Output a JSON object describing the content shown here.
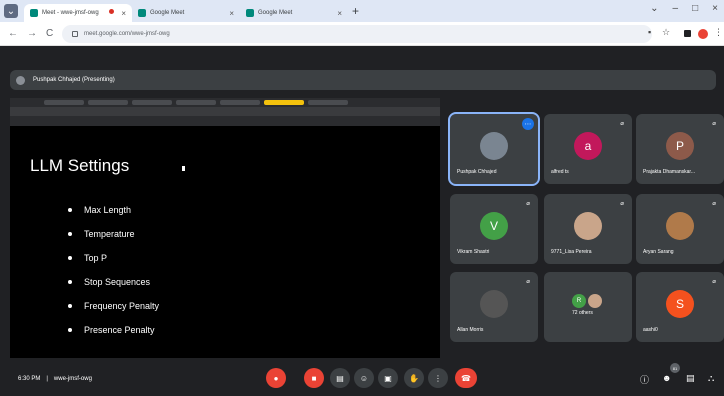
{
  "browser": {
    "tabs": [
      {
        "title": "Meet - wwe-jmsf-owg",
        "favicon_color": "#00897b"
      },
      {
        "title": "Google Meet",
        "favicon_color": "#00897b"
      },
      {
        "title": "Google Meet",
        "favicon_color": "#00897b"
      }
    ],
    "tab_close": "×",
    "new_tab": "+",
    "window_controls": [
      "⌄",
      "–",
      "□",
      "×"
    ],
    "url": "meet.google.com/wwe-jmsf-owg",
    "nav": [
      "←",
      "→",
      "C"
    ]
  },
  "presenter_bar": {
    "label": "Pushpak Chhajed (Presenting)"
  },
  "slide": {
    "title": "LLM Settings",
    "bullets": [
      "Max Length",
      "Temperature",
      "Top P",
      "Stop Sequences",
      "Frequency Penalty",
      "Presence Penalty"
    ]
  },
  "participants": [
    {
      "name": "Pushpak Chhajed",
      "avatar": "",
      "color": "#7a8591",
      "speaking": true
    },
    {
      "name": "alfred ts",
      "avatar": "a",
      "color": "#c2185b"
    },
    {
      "name": "Prajakta Dhamanskar...",
      "avatar": "P",
      "color": "#8d5a4a"
    },
    {
      "name": "Vikram Shastri",
      "avatar": "V",
      "color": "#43a047"
    },
    {
      "name": "9771_Lisa Pereira",
      "avatar": "",
      "color": "#c9a58a"
    },
    {
      "name": "Aryan Sarang",
      "avatar": "",
      "color": "#b07a4a"
    },
    {
      "name": "Allan Morris",
      "avatar": "",
      "color": "#555"
    },
    {
      "name": "72 others",
      "avatar": "R",
      "color": "#43a047"
    },
    {
      "name": "aashi0",
      "avatar": "S",
      "color": "#f4511e"
    }
  ],
  "meeting": {
    "time": "6:30 PM",
    "separator": "|",
    "code": "wwe-jmsf-owg",
    "participant_count": "81"
  },
  "colors": {
    "accent": "#1a73e8",
    "danger": "#ea4335",
    "bg": "#202124",
    "tile": "#3c4043"
  }
}
